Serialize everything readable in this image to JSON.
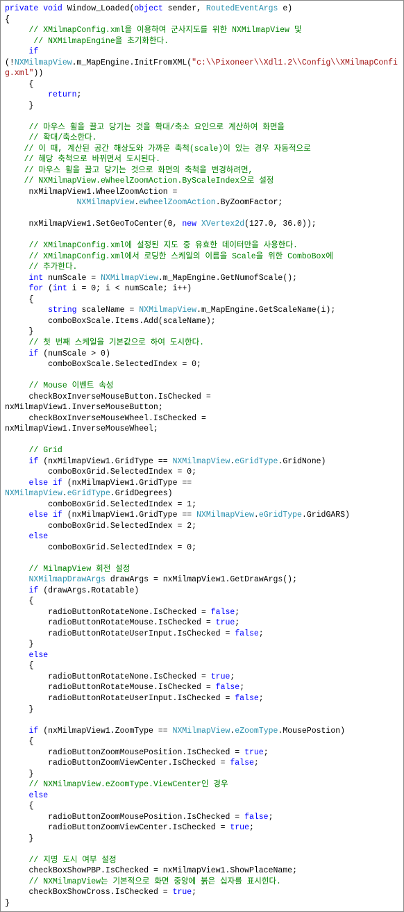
{
  "tokens": [
    {
      "t": "private",
      "c": "kw"
    },
    {
      "t": " "
    },
    {
      "t": "void",
      "c": "kw"
    },
    {
      "t": " Window_Loaded("
    },
    {
      "t": "object",
      "c": "kw"
    },
    {
      "t": " sender, "
    },
    {
      "t": "RoutedEventArgs",
      "c": "type"
    },
    {
      "t": " e)\n{\n     "
    },
    {
      "t": "// XMilmapConfig.xml을 이용하여 군사지도를 위한 NXMilmapView 및",
      "c": "cmt"
    },
    {
      "t": "\n      "
    },
    {
      "t": "// NXMilmapEngine을 초기화한다.",
      "c": "cmt"
    },
    {
      "t": "\n     "
    },
    {
      "t": "if",
      "c": "kw"
    },
    {
      "t": "\n(!"
    },
    {
      "t": "NXMilmapView",
      "c": "type"
    },
    {
      "t": ".m_MapEngine.InitFromXML("
    },
    {
      "t": "\"c:\\\\Pixoneer\\\\Xdl1.2\\\\Config\\\\XMilmapConfig.xml\"",
      "c": "str"
    },
    {
      "t": "))\n     {\n         "
    },
    {
      "t": "return",
      "c": "kw"
    },
    {
      "t": ";\n     }\n\n     "
    },
    {
      "t": "// 마우스 휠을 끌고 당기는 것을 확대/축소 요인으로 계산하여 화면을",
      "c": "cmt"
    },
    {
      "t": "\n     "
    },
    {
      "t": "// 확대/축소한다.",
      "c": "cmt"
    },
    {
      "t": "\n    "
    },
    {
      "t": "// 이 때, 계산된 공간 해상도와 가까운 축척(scale)이 있는 경우 자동적으로",
      "c": "cmt"
    },
    {
      "t": "\n    "
    },
    {
      "t": "// 해당 축척으로 바뀌면서 도시된다.",
      "c": "cmt"
    },
    {
      "t": "\n    "
    },
    {
      "t": "// 마우스 휠을 끌고 당기는 것으로 화면의 축척을 변경하려면,",
      "c": "cmt"
    },
    {
      "t": "\n    "
    },
    {
      "t": "// NXMilmapView.eWheelZoomAction.ByScaleIndex으로 설정",
      "c": "cmt"
    },
    {
      "t": "\n     nxMilmapView1.WheelZoomAction =\n               "
    },
    {
      "t": "NXMilmapView",
      "c": "type"
    },
    {
      "t": "."
    },
    {
      "t": "eWheelZoomAction",
      "c": "type"
    },
    {
      "t": ".ByZoomFactor;\n\n     nxMilmapView1.SetGeoToCenter(0, "
    },
    {
      "t": "new",
      "c": "kw"
    },
    {
      "t": " "
    },
    {
      "t": "XVertex2d",
      "c": "type"
    },
    {
      "t": "(127.0, 36.0));\n\n     "
    },
    {
      "t": "// XMilmapConfig.xml에 설정된 지도 중 유효한 데이터만을 사용한다.",
      "c": "cmt"
    },
    {
      "t": "\n     "
    },
    {
      "t": "// XMilmapConfig.xml에서 로딩한 스케일의 이름을 Scale을 위한 ComboBox에",
      "c": "cmt"
    },
    {
      "t": "\n     "
    },
    {
      "t": "// 추가한다.",
      "c": "cmt"
    },
    {
      "t": "\n     "
    },
    {
      "t": "int",
      "c": "kw"
    },
    {
      "t": " numScale = "
    },
    {
      "t": "NXMilmapView",
      "c": "type"
    },
    {
      "t": ".m_MapEngine.GetNumofScale();\n     "
    },
    {
      "t": "for",
      "c": "kw"
    },
    {
      "t": " ("
    },
    {
      "t": "int",
      "c": "kw"
    },
    {
      "t": " i = 0; i < numScale; i++)\n     {\n         "
    },
    {
      "t": "string",
      "c": "kw"
    },
    {
      "t": " scaleName = "
    },
    {
      "t": "NXMilmapView",
      "c": "type"
    },
    {
      "t": ".m_MapEngine.GetScaleName(i);\n         comboBoxScale.Items.Add(scaleName);\n     }\n     "
    },
    {
      "t": "// 첫 번째 스케일을 기본값으로 하여 도시한다.",
      "c": "cmt"
    },
    {
      "t": "\n     "
    },
    {
      "t": "if",
      "c": "kw"
    },
    {
      "t": " (numScale > 0)\n         comboBoxScale.SelectedIndex = 0;\n\n     "
    },
    {
      "t": "// Mouse 이벤트 속성",
      "c": "cmt"
    },
    {
      "t": "\n     checkBoxInverseMouseButton.IsChecked =\nnxMilmapView1.InverseMouseButton;\n     checkBoxInverseMouseWheel.IsChecked =\nnxMilmapView1.InverseMouseWheel;\n\n     "
    },
    {
      "t": "// Grid",
      "c": "cmt"
    },
    {
      "t": "\n     "
    },
    {
      "t": "if",
      "c": "kw"
    },
    {
      "t": " (nxMilmapView1.GridType == "
    },
    {
      "t": "NXMilmapView",
      "c": "type"
    },
    {
      "t": "."
    },
    {
      "t": "eGridType",
      "c": "type"
    },
    {
      "t": ".GridNone)\n         comboBoxGrid.SelectedIndex = 0;\n     "
    },
    {
      "t": "else",
      "c": "kw"
    },
    {
      "t": " "
    },
    {
      "t": "if",
      "c": "kw"
    },
    {
      "t": " (nxMilmapView1.GridType ==\n"
    },
    {
      "t": "NXMilmapView",
      "c": "type"
    },
    {
      "t": "."
    },
    {
      "t": "eGridType",
      "c": "type"
    },
    {
      "t": ".GridDegrees)\n         comboBoxGrid.SelectedIndex = 1;\n     "
    },
    {
      "t": "else",
      "c": "kw"
    },
    {
      "t": " "
    },
    {
      "t": "if",
      "c": "kw"
    },
    {
      "t": " (nxMilmapView1.GridType == "
    },
    {
      "t": "NXMilmapView",
      "c": "type"
    },
    {
      "t": "."
    },
    {
      "t": "eGridType",
      "c": "type"
    },
    {
      "t": ".GridGARS)\n         comboBoxGrid.SelectedIndex = 2;\n     "
    },
    {
      "t": "else",
      "c": "kw"
    },
    {
      "t": "\n         comboBoxGrid.SelectedIndex = 0;\n\n     "
    },
    {
      "t": "// MilmapView 회전 설정",
      "c": "cmt"
    },
    {
      "t": "\n     "
    },
    {
      "t": "NXMilmapDrawArgs",
      "c": "type"
    },
    {
      "t": " drawArgs = nxMilmapView1.GetDrawArgs();\n     "
    },
    {
      "t": "if",
      "c": "kw"
    },
    {
      "t": " (drawArgs.Rotatable)\n     {\n         radioButtonRotateNone.IsChecked = "
    },
    {
      "t": "false",
      "c": "kw"
    },
    {
      "t": ";\n         radioButtonRotateMouse.IsChecked = "
    },
    {
      "t": "true",
      "c": "kw"
    },
    {
      "t": ";\n         radioButtonRotateUserInput.IsChecked = "
    },
    {
      "t": "false",
      "c": "kw"
    },
    {
      "t": ";\n     }\n     "
    },
    {
      "t": "else",
      "c": "kw"
    },
    {
      "t": "\n     {\n         radioButtonRotateNone.IsChecked = "
    },
    {
      "t": "true",
      "c": "kw"
    },
    {
      "t": ";\n         radioButtonRotateMouse.IsChecked = "
    },
    {
      "t": "false",
      "c": "kw"
    },
    {
      "t": ";\n         radioButtonRotateUserInput.IsChecked = "
    },
    {
      "t": "false",
      "c": "kw"
    },
    {
      "t": ";\n     }\n\n     "
    },
    {
      "t": "if",
      "c": "kw"
    },
    {
      "t": " (nxMilmapView1.ZoomType == "
    },
    {
      "t": "NXMilmapView",
      "c": "type"
    },
    {
      "t": "."
    },
    {
      "t": "eZoomType",
      "c": "type"
    },
    {
      "t": ".MousePostion)\n     {\n         radioButtonZoomMousePosition.IsChecked = "
    },
    {
      "t": "true",
      "c": "kw"
    },
    {
      "t": ";\n         radioButtonZoomViewCenter.IsChecked = "
    },
    {
      "t": "false",
      "c": "kw"
    },
    {
      "t": ";\n     }\n     "
    },
    {
      "t": "// NXMilmapView.eZoomType.ViewCenter인 경우",
      "c": "cmt"
    },
    {
      "t": "\n     "
    },
    {
      "t": "else",
      "c": "kw"
    },
    {
      "t": "\n     {\n         radioButtonZoomMousePosition.IsChecked = "
    },
    {
      "t": "false",
      "c": "kw"
    },
    {
      "t": ";\n         radioButtonZoomViewCenter.IsChecked = "
    },
    {
      "t": "true",
      "c": "kw"
    },
    {
      "t": ";\n     }\n\n     "
    },
    {
      "t": "// 지명 도시 여부 설정",
      "c": "cmt"
    },
    {
      "t": "\n     checkBoxShowPBP.IsChecked = nxMilmapView1.ShowPlaceName;\n     "
    },
    {
      "t": "// NXMilmapView는 기본적으로 화면 중앙에 붉은 십자를 표시힌다.",
      "c": "cmt"
    },
    {
      "t": "\n     checkBoxShowCross.IsChecked = "
    },
    {
      "t": "true",
      "c": "kw"
    },
    {
      "t": ";\n}"
    }
  ]
}
